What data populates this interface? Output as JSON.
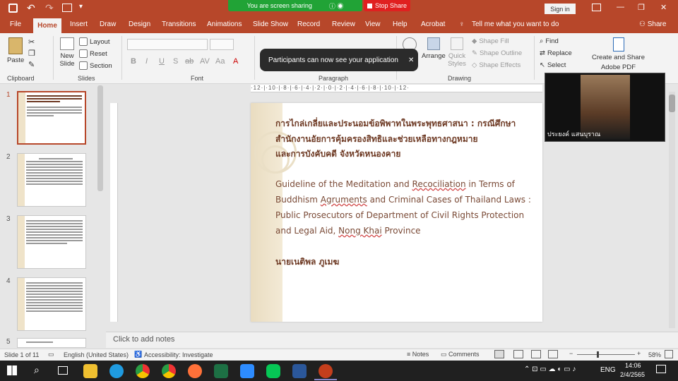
{
  "titlebar": {
    "sign_in": "Sign in",
    "minimize": "—",
    "restore": "❐",
    "close": "✕"
  },
  "share": {
    "status": "You are screen sharing",
    "stop": "Stop Share",
    "toast": "Participants can now see your application"
  },
  "tabs": [
    "File",
    "Home",
    "Insert",
    "Draw",
    "Design",
    "Transitions",
    "Animations",
    "Slide Show",
    "Record",
    "Review",
    "View",
    "Help",
    "Acrobat"
  ],
  "tell_me": "Tell me what you want to do",
  "share_btn": "Share",
  "ribbon": {
    "paste": "Paste",
    "new_slide": "New Slide",
    "layout": "Layout",
    "reset": "Reset",
    "section": "Section",
    "arrange": "Arrange",
    "quick_styles": "Quick Styles",
    "shape_fill": "Shape Fill",
    "shape_outline": "Shape Outline",
    "shape_effects": "Shape Effects",
    "find": "Find",
    "replace": "Replace",
    "select": "Select",
    "create_share": "Create and Share",
    "adobe_pdf": "Adobe PDF",
    "groups": {
      "clipboard": "Clipboard",
      "slides": "Slides",
      "font": "Font",
      "paragraph": "Paragraph",
      "drawing": "Drawing"
    }
  },
  "thumbnails": [
    "1",
    "2",
    "3",
    "4",
    "5"
  ],
  "ruler_text": "·12·|·10·|·8·|·6·|·4·|·2·|·0·|·2·|·4·|·6·|·8·|·10·|·12·",
  "slide": {
    "th_title_1": "การไกล่เกลี่ยและประนอมข้อพิพาทในพระพุทธศาสนา : กรณีศึกษา",
    "th_title_2": "สำนักงานอัยการคุ้มครองสิทธิและช่วยเหลือทางกฎหมาย",
    "th_title_3": "และการบังคับคดี จังหวัดหนองคาย",
    "en_1a": "Guideline of the Meditation and ",
    "en_1b": "Recociliation",
    "en_1c": " in Terms of",
    "en_2a": "Buddhism ",
    "en_2b": "Agruments",
    "en_2c": " and Criminal Cases of Thailand Laws :",
    "en_3": "Public Prosecutors of Department of Civil Rights Protection",
    "en_4a": "and Legal Aid, ",
    "en_4b": "Nong Khai",
    "en_4c": " Province",
    "author": "นายเนติพล ภูเมฆ"
  },
  "notes": "Click to add notes",
  "status": {
    "slide": "Slide 1 of 11",
    "lang": "English (United States)",
    "accessibility": "Accessibility: Investigate",
    "notes": "Notes",
    "comments": "Comments",
    "zoom": "58%"
  },
  "video": {
    "name": "ประยงค์ แสนบุราณ"
  },
  "taskbar": {
    "lang": "ENG",
    "time": "14:06",
    "date": "2/4/2565"
  }
}
